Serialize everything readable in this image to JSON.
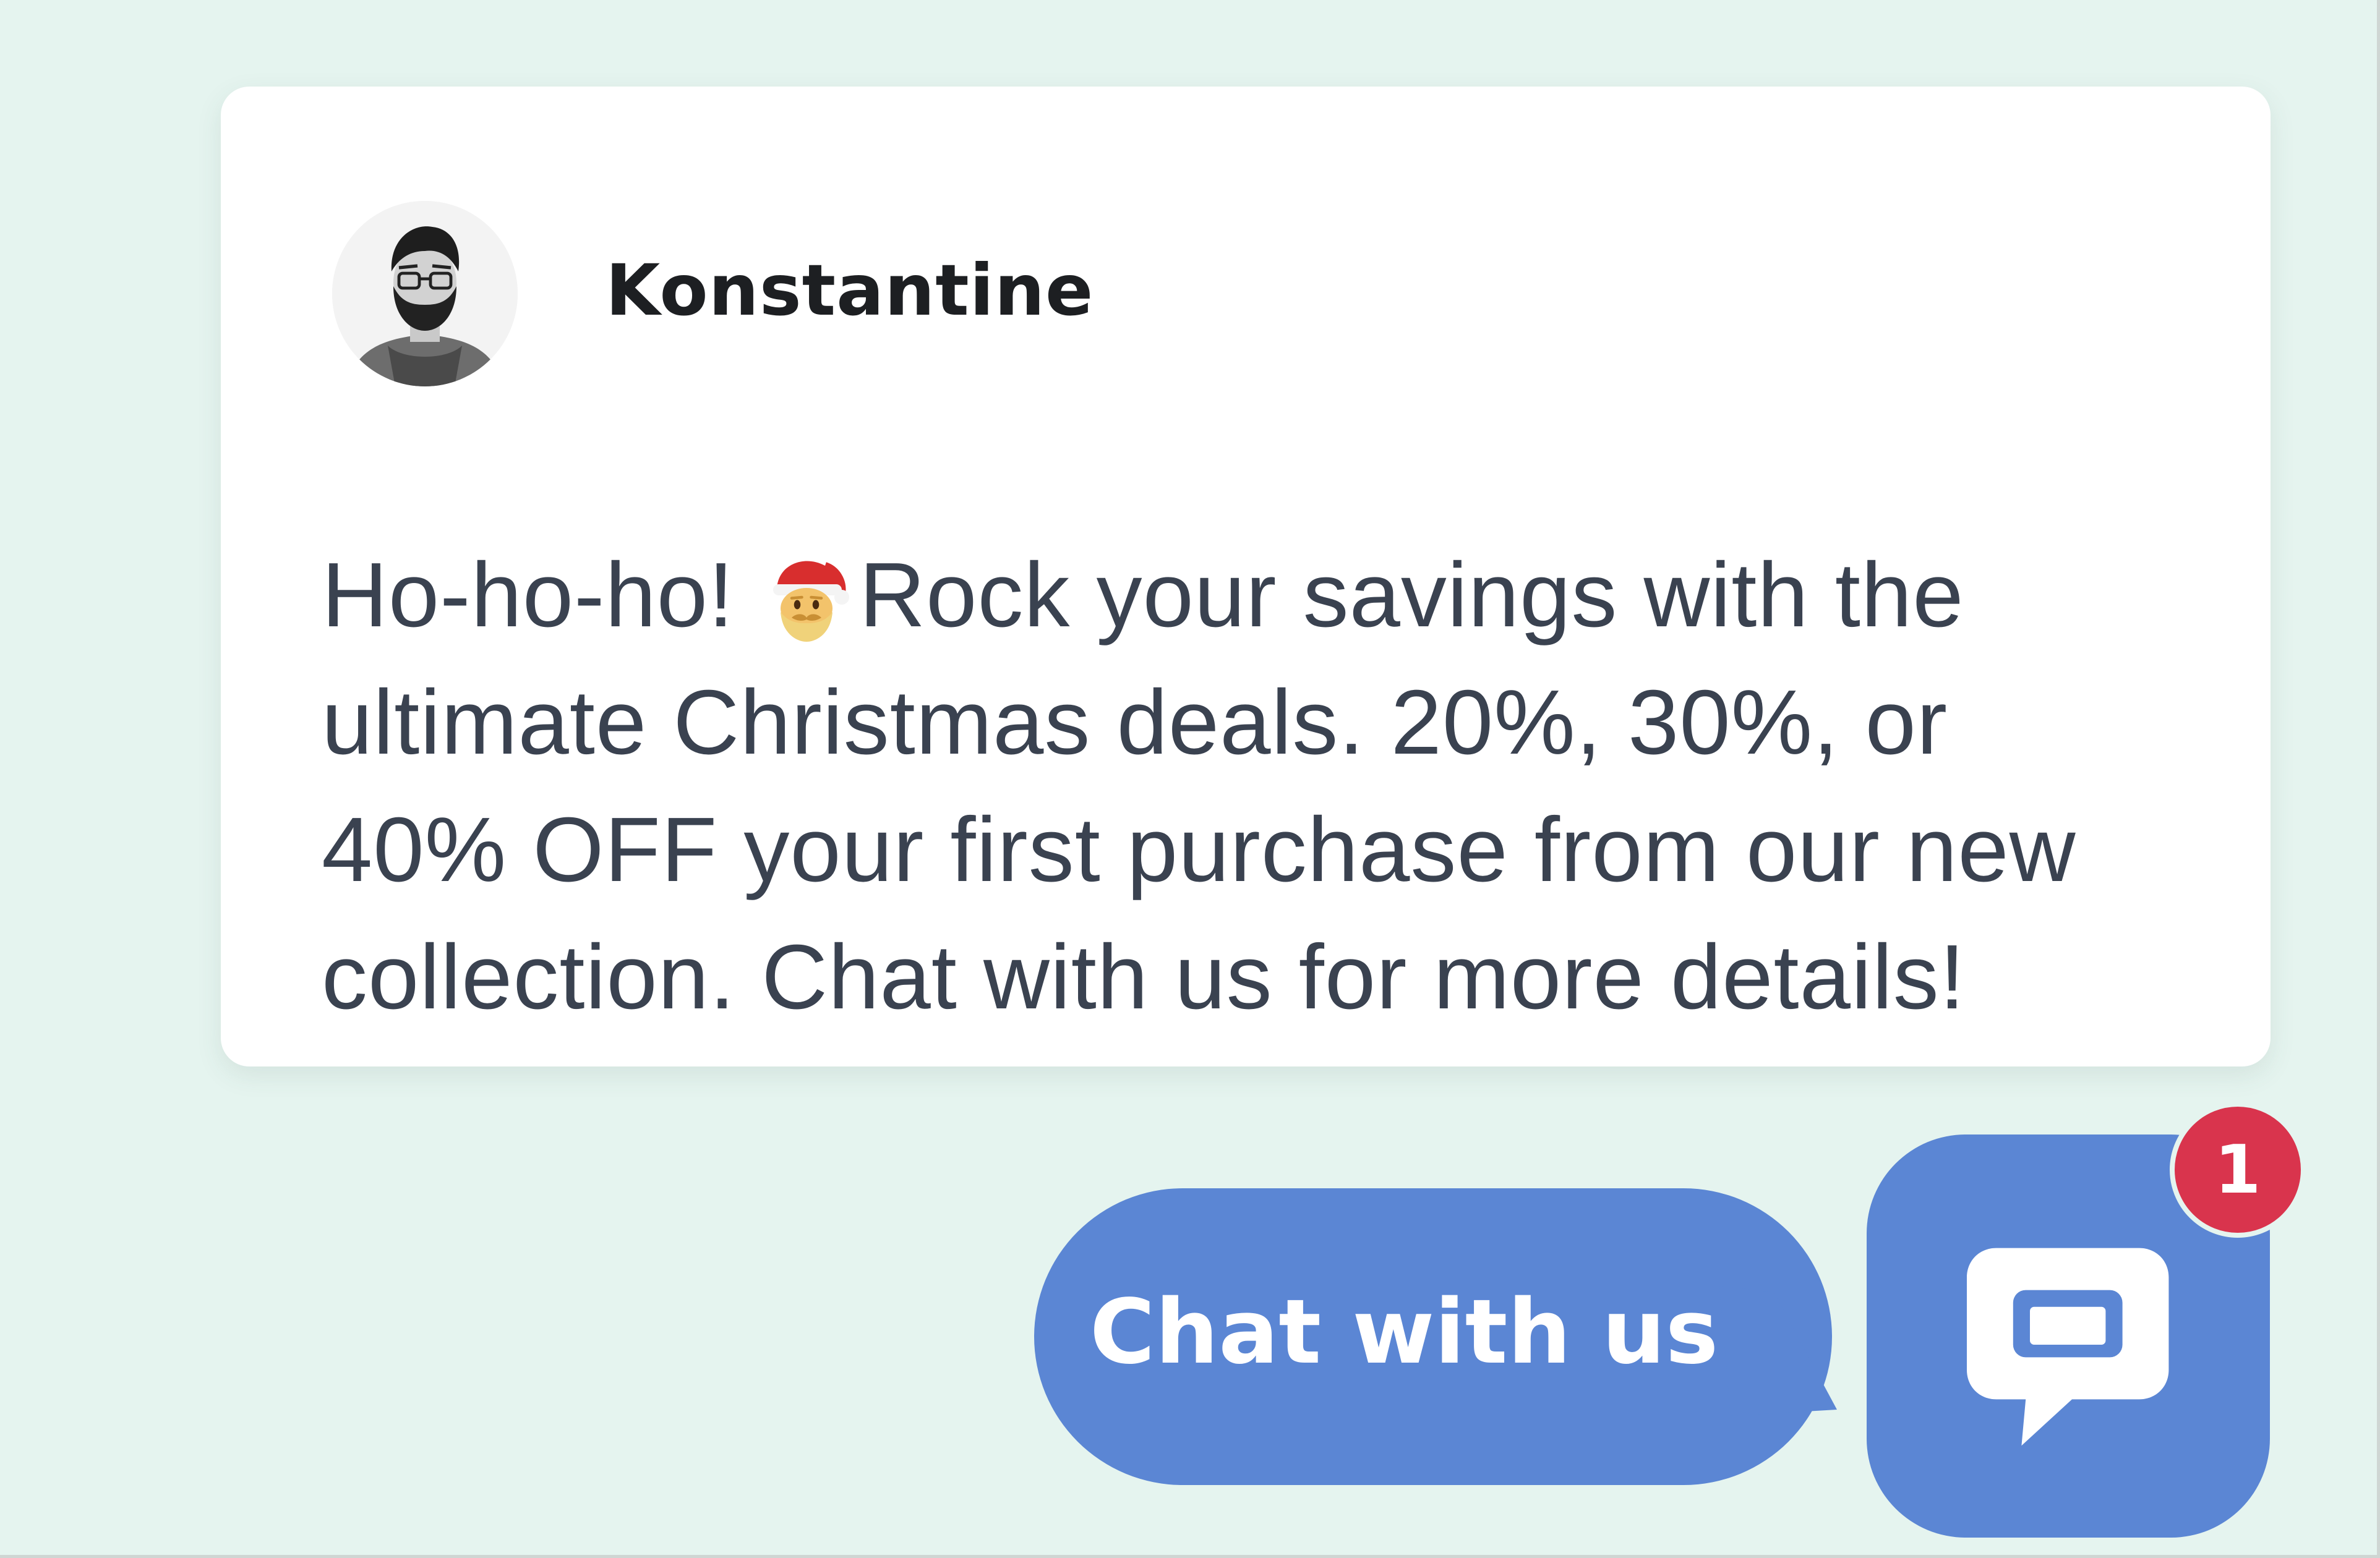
{
  "popup": {
    "agent": {
      "name": "Konstantine",
      "avatar_icon": "agent-avatar-photo"
    },
    "message": {
      "lines": [
        {
          "before_emoji": "Ho-ho-ho! ",
          "emoji": "santa-claus-emoji",
          "after_emoji": "Rock your savings with the"
        },
        {
          "text": "ultimate Christmas deals. 20%, 30%, or"
        },
        {
          "text": "40% OFF your first purchase from our new"
        },
        {
          "text": "collection. Chat with us for more details!"
        }
      ]
    }
  },
  "cta": {
    "label": "Chat with us!"
  },
  "launcher": {
    "icon": "chat-bubble-icon",
    "unread_count": "1"
  },
  "colors": {
    "background": "#e5f4ef",
    "card": "#ffffff",
    "accent": "#5b86d4",
    "badge": "#d9344d",
    "message_text": "#3a4250",
    "name_text": "#1d1f22"
  }
}
